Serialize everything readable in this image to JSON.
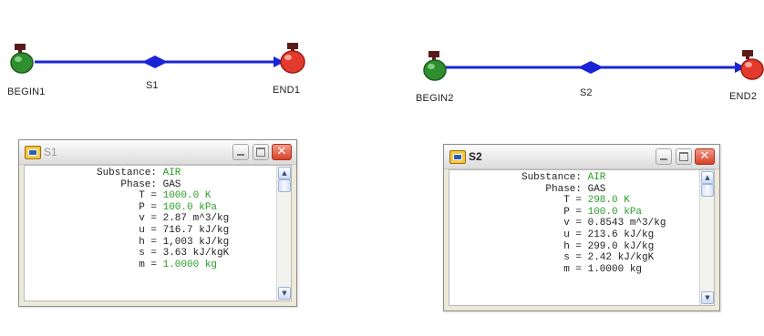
{
  "diagram": {
    "line_color": "#1a24d6",
    "begin_color": "#2f8f2f",
    "end_color": "#e23a2c",
    "flow1": {
      "begin": "BEGIN1",
      "stream": "S1",
      "end": "END1"
    },
    "flow2": {
      "begin": "BEGIN2",
      "stream": "S2",
      "end": "END2"
    }
  },
  "windows": [
    {
      "title": "S1",
      "active": false,
      "rows": [
        {
          "k": "Substance:",
          "v": "AIR",
          "green": true
        },
        {
          "k": "Phase:",
          "v": "GAS",
          "green": false
        },
        {
          "k": "T =",
          "v": "1000.0 K",
          "green": true
        },
        {
          "k": "P =",
          "v": "100.0 kPa",
          "green": true
        },
        {
          "k": "v =",
          "v": "2.87 m^3/kg",
          "green": false
        },
        {
          "k": "u =",
          "v": "716.7 kJ/kg",
          "green": false
        },
        {
          "k": "h =",
          "v": "1,003 kJ/kg",
          "green": false
        },
        {
          "k": "s =",
          "v": "3.63 kJ/kgK",
          "green": false
        },
        {
          "k": "m =",
          "v": "1.0000 kg",
          "green": true
        }
      ]
    },
    {
      "title": "S2",
      "active": true,
      "rows": [
        {
          "k": "Substance:",
          "v": "AIR",
          "green": true
        },
        {
          "k": "Phase:",
          "v": "GAS",
          "green": false
        },
        {
          "k": "T =",
          "v": "298.0 K",
          "green": true
        },
        {
          "k": "P =",
          "v": "100.0 kPa",
          "green": true
        },
        {
          "k": "v =",
          "v": "0.8543 m^3/kg",
          "green": false
        },
        {
          "k": "u =",
          "v": "213.6 kJ/kg",
          "green": false
        },
        {
          "k": "h =",
          "v": "299.0 kJ/kg",
          "green": false
        },
        {
          "k": "s =",
          "v": "2.42 kJ/kgK",
          "green": false
        },
        {
          "k": "m =",
          "v": "1.0000 kg",
          "green": false
        }
      ]
    }
  ]
}
